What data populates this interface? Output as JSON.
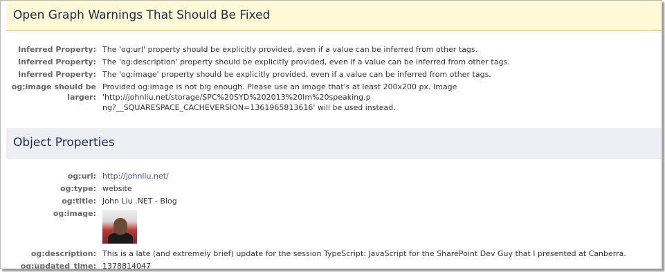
{
  "warnings": {
    "title": "Open Graph Warnings That Should Be Fixed",
    "rows": [
      {
        "key": "Inferred Property:",
        "value": "The 'og:url' property should be explicitly provided, even if a value can be inferred from other tags."
      },
      {
        "key": "Inferred Property:",
        "value": "The 'og:description' property should be explicitly provided, even if a value can be inferred from other tags."
      },
      {
        "key": "Inferred Property:",
        "value": "The 'og:image' property should be explicitly provided, even if a value can be inferred from other tags."
      },
      {
        "key_line1": "og:image should be",
        "key_line2": "larger:",
        "value_line1": "Provided og:image is not big enough. Please use an image that's at least 200x200 px. Image 'http://johnliu.net/storage/SPC%20SYD%202013%20Im%20speaking.p",
        "value_line2": "ng?__SQUARESPACE_CACHEVERSION=1361965813616' will be used instead."
      }
    ]
  },
  "object": {
    "title": "Object Properties",
    "url_key": "og:url:",
    "url_value": "http://johnliu.net/",
    "type_key": "og:type:",
    "type_value": "website",
    "title_key": "og:title:",
    "title_value": "John Liu .NET - Blog",
    "image_key": "og:image:",
    "description_key": "og:description:",
    "description_value": "This is a late (and extremely brief) update for the session TypeScript: JavaScript for the SharePoint Dev Guy that I presented at Canberra.",
    "updated_key": "og:updated_time:",
    "updated_value": "1378814047"
  },
  "colors": {
    "warning_bg": "#fff9d7",
    "warning_border": "#e2c822",
    "object_bg": "#edeff4",
    "link": "#3b5998"
  }
}
